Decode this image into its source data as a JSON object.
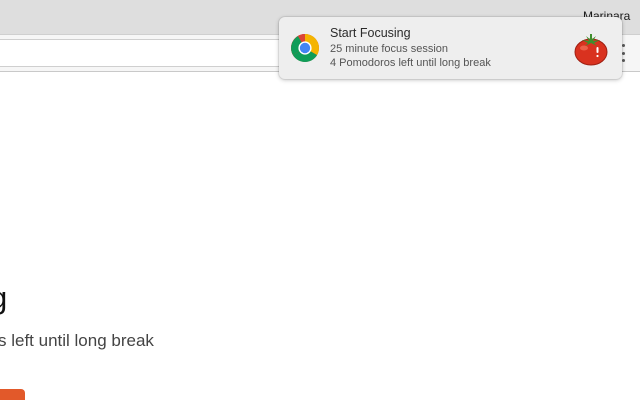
{
  "browser": {
    "profile_name": "Marinara",
    "menu_icon": "more-vert-icon"
  },
  "page": {
    "title": "g",
    "subtitle": "s left until long break",
    "button_color": "#e2592a"
  },
  "notification": {
    "app_icon": "chrome-icon",
    "title": "Start Focusing",
    "lines": [
      "25 minute focus session",
      "4 Pomodoros left until long break"
    ],
    "image_icon": "tomato-icon"
  }
}
